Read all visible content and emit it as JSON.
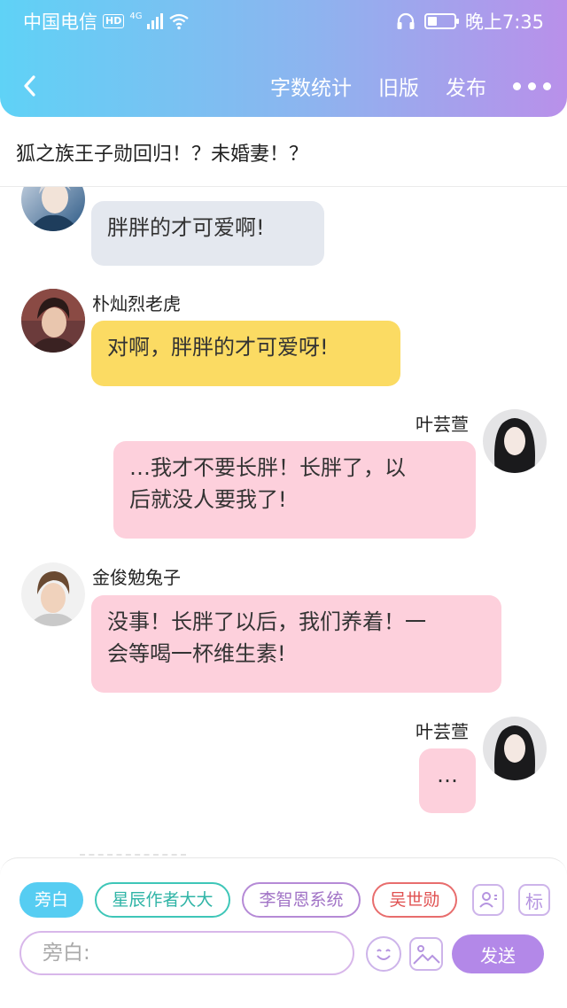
{
  "status_bar": {
    "carrier": "中国电信",
    "hd_badge": "HD",
    "network": "4G",
    "time": "晚上7:35",
    "battery_level": 0.35
  },
  "toolbar": {
    "back_icon": "chevron-left-icon",
    "word_count_label": "字数统计",
    "old_version_label": "旧版",
    "publish_label": "发布",
    "more_icon": "more-dots-icon"
  },
  "story": {
    "title": "狐之族王子勋回归！？未婚妻！？"
  },
  "messages": [
    {
      "speaker": "",
      "text": "胖胖的才可爱啊!",
      "side": "left",
      "color": "#e4e8ef"
    },
    {
      "speaker": "朴灿烈老虎",
      "text": "对啊，胖胖的才可爱呀!",
      "side": "left",
      "color": "#fbdb63"
    },
    {
      "speaker": "叶芸萱",
      "text_line1": "…我才不要长胖！长胖了，以",
      "text_line2": "后就没人要我了!",
      "side": "right",
      "color": "#fdd0dc"
    },
    {
      "speaker": "金俊勉兔子",
      "text_line1": "没事！长胖了以后，我们养着！一",
      "text_line2": "会等喝一杯维生素!",
      "side": "left",
      "color": "#fdd0dc"
    },
    {
      "speaker": "叶芸萱",
      "text": "…",
      "side": "right",
      "color": "#fdd0dc"
    }
  ],
  "roles": {
    "narration": "旁白",
    "author": "星辰作者大大",
    "system": "李智恩系统",
    "wu": "吴世勋"
  },
  "panel": {
    "person_icon": "person-card-icon",
    "mark_label": "标",
    "input_placeholder": "旁白:",
    "input_value": "",
    "emoji_icon": "smiley-icon",
    "image_icon": "image-icon",
    "send_label": "发送"
  }
}
